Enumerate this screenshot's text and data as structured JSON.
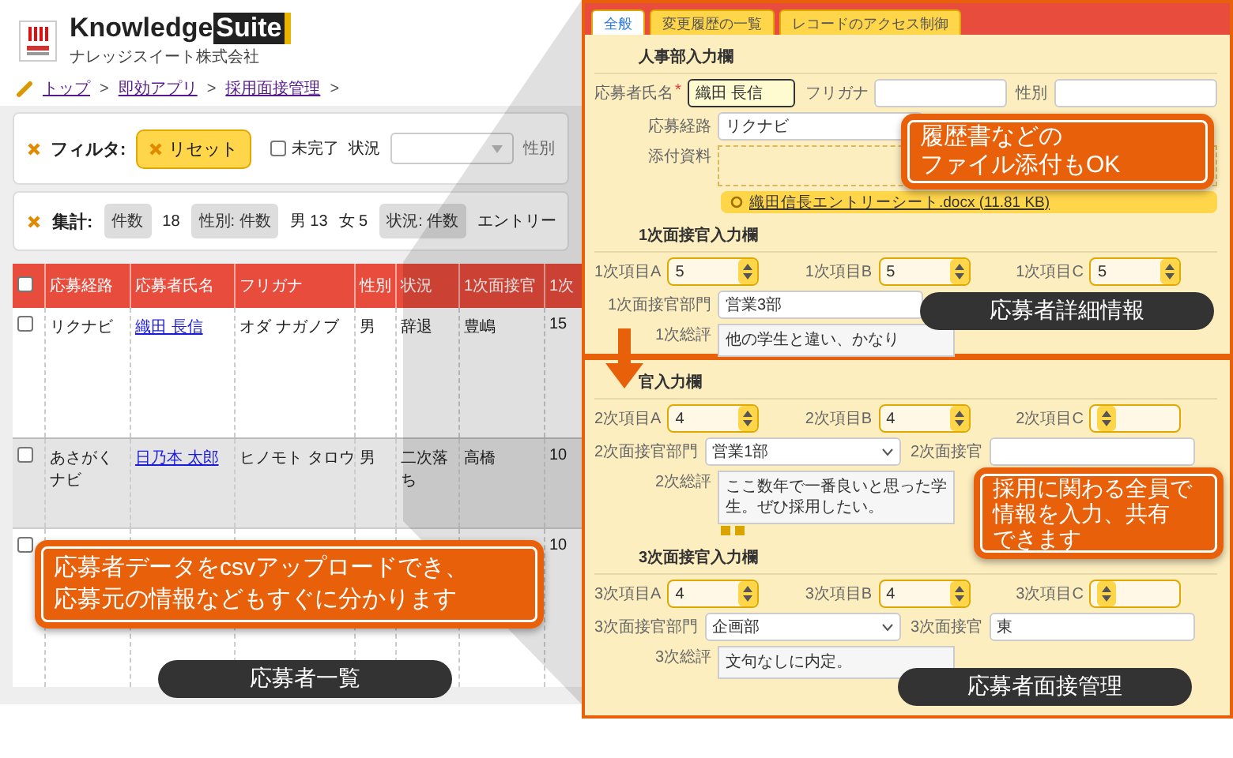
{
  "header": {
    "brand": "Knowledge",
    "brand_highlight": "Suite",
    "company": "ナレッジスイート株式会社"
  },
  "breadcrumb": [
    {
      "label": "トップ",
      "separator": ">"
    },
    {
      "label": "即効アプリ",
      "separator": ">"
    },
    {
      "label": "採用面接管理",
      "separator": ">"
    }
  ],
  "filter": {
    "label": "フィルタ:",
    "reset_button": "リセット",
    "incomplete": {
      "label": "未完了",
      "checked": false
    },
    "status_label": "状況",
    "gender_label": "性別"
  },
  "summary": {
    "label": "集計:",
    "items": [
      {
        "kind": "chip",
        "text": "件数"
      },
      {
        "kind": "value",
        "text": "18"
      },
      {
        "kind": "chip",
        "text": "性別: 件数"
      },
      {
        "kind": "value",
        "text": "男 13"
      },
      {
        "kind": "value",
        "text": "女 5"
      },
      {
        "kind": "chip",
        "text": "状況: 件数"
      },
      {
        "kind": "value",
        "text": "エントリー"
      }
    ]
  },
  "table": {
    "header_checkbox": {
      "checked": false
    },
    "columns": [
      "応募経路",
      "応募者氏名",
      "フリガナ",
      "性別",
      "状況",
      "1次面接官",
      "1次"
    ],
    "rows": [
      {
        "selected": false,
        "checked": false,
        "cells": [
          "リクナビ",
          "織田 長信",
          "オダ ナガノブ",
          "男",
          "辞退",
          "豊嶋",
          "15"
        ]
      },
      {
        "selected": true,
        "checked": false,
        "cells": [
          "あさがくナビ",
          "日乃本 太郎",
          "ヒノモト タロウ",
          "男",
          "二次落ち",
          "高橋",
          "10"
        ]
      },
      {
        "selected": false,
        "checked": false,
        "cells": [
          null,
          null,
          null,
          null,
          null,
          null,
          "10"
        ]
      }
    ]
  },
  "list_callout": [
    "応募者データをcsvアップロードでき、",
    "応募元の情報などもすぐに分かります"
  ],
  "list_caption": "応募者一覧",
  "detail_panel": {
    "tabs": [
      {
        "label": "全般",
        "selected": true
      },
      {
        "label": "変更履歴の一覧",
        "selected": false
      },
      {
        "label": "レコードのアクセス制御",
        "selected": false
      }
    ],
    "sections": [
      {
        "title": "人事部入力欄",
        "rows": [
          [
            {
              "kind": "text",
              "label": "応募者氏名",
              "mark": "*",
              "value": "織田 長信",
              "focused": true
            },
            {
              "kind": "text",
              "label": "フリガナ",
              "focused": false
            },
            {
              "kind": "text",
              "label": "性別",
              "focused": false
            }
          ],
          [
            {
              "kind": "select",
              "label": "応募経路",
              "value": "リクナビ"
            }
          ],
          [
            {
              "kind": "attachment",
              "label": "添付資料",
              "file": "織田信長エントリーシート.docx (11.81 KB)"
            }
          ]
        ]
      },
      {
        "title": "1次面接官入力欄",
        "rows": [
          [
            {
              "kind": "spinner",
              "label": "1次項目A",
              "value": "5"
            },
            {
              "kind": "spinner",
              "label": "1次項目B",
              "value": "5"
            },
            {
              "kind": "spinner",
              "label": "1次項目C",
              "value": "5"
            }
          ],
          [
            {
              "kind": "text",
              "label": "1次面接官部門",
              "value": "営業3部",
              "focused": false
            }
          ],
          [
            {
              "kind": "textarea",
              "label": "1次総評",
              "value": "他の学生と違い、かなり"
            }
          ]
        ]
      }
    ],
    "callout": [
      "履歴書などの",
      "ファイル添付もOK"
    ],
    "caption": "応募者詳細情報"
  },
  "interview_panel": {
    "sections": [
      {
        "title": "官入力欄",
        "rows": [
          [
            {
              "kind": "spinner",
              "label": "2次項目A",
              "value": "4"
            },
            {
              "kind": "spinner",
              "label": "2次項目B",
              "value": "4"
            },
            {
              "kind": "spinner",
              "label": "2次項目C"
            }
          ],
          [
            {
              "kind": "select",
              "label": "2次面接官部門",
              "value": "営業1部"
            },
            {
              "kind": "text",
              "label": "2次面接官",
              "focused": false
            }
          ],
          [
            {
              "kind": "textarea",
              "label": "2次総評",
              "value": "ここ数年で一番良いと思った学生。ぜひ採用したい。",
              "toolbar": true
            }
          ]
        ]
      },
      {
        "title": "3次面接官入力欄",
        "rows": [
          [
            {
              "kind": "spinner",
              "label": "3次項目A",
              "value": "4"
            },
            {
              "kind": "spinner",
              "label": "3次項目B",
              "value": "4"
            },
            {
              "kind": "spinner",
              "label": "3次項目C"
            }
          ],
          [
            {
              "kind": "select",
              "label": "3次面接官部門",
              "value": "企画部"
            },
            {
              "kind": "text",
              "label": "3次面接官",
              "value": "東",
              "focused": false
            }
          ],
          [
            {
              "kind": "textarea",
              "label": "3次総評",
              "value": "文句なしに内定。"
            }
          ]
        ]
      }
    ],
    "callout": [
      "採用に関わる全員で",
      "情報を入力、共有",
      "できます"
    ],
    "caption": "応募者面接管理"
  }
}
